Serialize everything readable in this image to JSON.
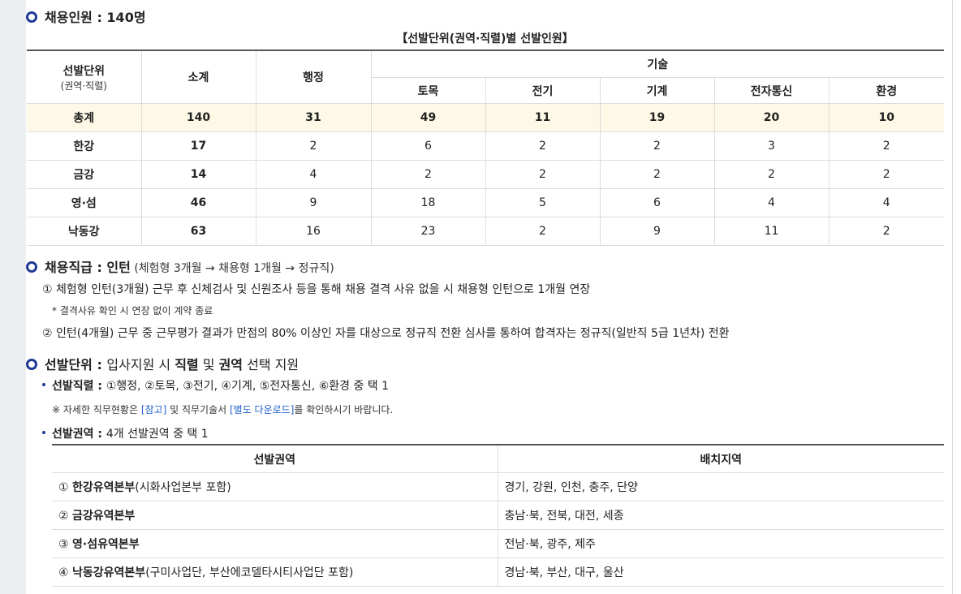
{
  "section1": {
    "label": "채용인원 : ",
    "value": "140명"
  },
  "table1": {
    "caption": "【선발단위(권역·직렬)별 선발인원】",
    "head": {
      "unit": "선발단위",
      "unit_sub": "(권역·직렬)",
      "subtotal": "소계",
      "admin": "행정",
      "tech": "기술",
      "tech_cols": [
        "토목",
        "전기",
        "기계",
        "전자통신",
        "환경"
      ]
    },
    "rows": [
      {
        "name": "총계",
        "values": [
          "140",
          "31",
          "49",
          "11",
          "19",
          "20",
          "10"
        ]
      },
      {
        "name": "한강",
        "values": [
          "17",
          "2",
          "6",
          "2",
          "2",
          "3",
          "2"
        ]
      },
      {
        "name": "금강",
        "values": [
          "14",
          "4",
          "2",
          "2",
          "2",
          "2",
          "2"
        ]
      },
      {
        "name": "영·섬",
        "values": [
          "46",
          "9",
          "18",
          "5",
          "6",
          "4",
          "4"
        ]
      },
      {
        "name": "낙동강",
        "values": [
          "63",
          "16",
          "23",
          "2",
          "9",
          "11",
          "2"
        ]
      }
    ]
  },
  "section2": {
    "label": "채용직급 : ",
    "value": "인턴",
    "sub": " (체험형 3개월 → 채용형 1개월 → 정규직)",
    "item1": "① 체험형 인턴(3개월) 근무 후 신체검사 및 신원조사 등을 통해 채용 결격 사유 없을 시 채용형 인턴으로 1개월 연장",
    "note1": "* 결격사유 확인 시 연장 없이 계약 종료",
    "item2": "② 인턴(4개월) 근무 중 근무평가 결과가 만점의 80% 이상인 자를 대상으로 정규직 전환 심사를 통하여 합격자는 정규직(일반직 5급 1년차) 전환"
  },
  "section3": {
    "label": "선발단위 : ",
    "t1": "입사지원 시 ",
    "b1": "직렬",
    "t2": " 및 ",
    "b2": "권역",
    "t3": " 선택 지원",
    "series_label": "선발직렬 : ",
    "series_text": "①행정, ②토목, ③전기, ④기계, ⑤전자통신, ⑥환경 중 택 1",
    "note_a": "※ 자세한 직무현황은 ",
    "note_link1": "[참고]",
    "note_b": " 및 직무기술서 ",
    "note_link2": "[별도 다운로드]",
    "note_c": "를 확인하시기 바랍니다.",
    "region_label": "선발권역 : ",
    "region_text": "4개 선발권역 중 택 1"
  },
  "table2": {
    "head": [
      "선발권역",
      "배치지역"
    ],
    "rows": [
      {
        "num": "① ",
        "name": "한강유역본부",
        "extra": "(시화사업본부 포함)",
        "area": "경기, 강원, 인천, 충주, 단양"
      },
      {
        "num": "② ",
        "name": "금강유역본부",
        "extra": "",
        "area": "충남·북, 전북, 대전, 세종"
      },
      {
        "num": "③ ",
        "name": "영·섬유역본부",
        "extra": "",
        "area": "전남·북, 광주, 제주"
      },
      {
        "num": "④ ",
        "name": "낙동강유역본부",
        "extra": "(구미사업단, 부산에코델타시티사업단 포함)",
        "area": "경남·북, 부산, 대구, 울산"
      }
    ]
  },
  "colors": {
    "accent": "#1f3a93",
    "total_row_bg": "#fef9e7",
    "link": "#1f5fcc"
  }
}
